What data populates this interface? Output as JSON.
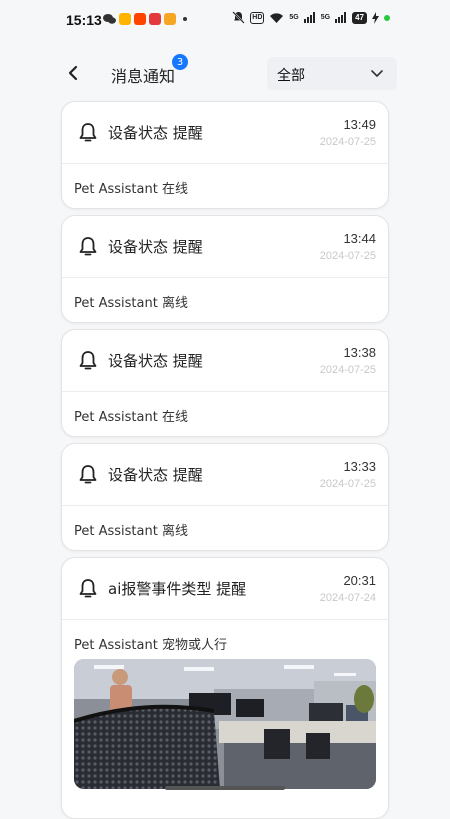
{
  "status_bar": {
    "time": "15:13",
    "hd_label": "HD",
    "net1": "5G",
    "net2": "5G",
    "battery": "47"
  },
  "header": {
    "title": "消息通知",
    "badge_count": "3",
    "filter_value": "全部"
  },
  "notifications": [
    {
      "title": "设备状态 提醒",
      "time": "13:49",
      "date": "2024-07-25",
      "body": "Pet Assistant 在线"
    },
    {
      "title": "设备状态 提醒",
      "time": "13:44",
      "date": "2024-07-25",
      "body": "Pet Assistant 离线"
    },
    {
      "title": "设备状态 提醒",
      "time": "13:38",
      "date": "2024-07-25",
      "body": "Pet Assistant 在线"
    },
    {
      "title": "设备状态 提醒",
      "time": "13:33",
      "date": "2024-07-25",
      "body": "Pet Assistant 离线"
    },
    {
      "title": "ai报警事件类型 提醒",
      "time": "20:31",
      "date": "2024-07-24",
      "body": "Pet Assistant 宠物或人行"
    }
  ],
  "colors": {
    "accent": "#1677ff",
    "date_text": "#c8c8c8",
    "online_dot": "#28c840"
  }
}
